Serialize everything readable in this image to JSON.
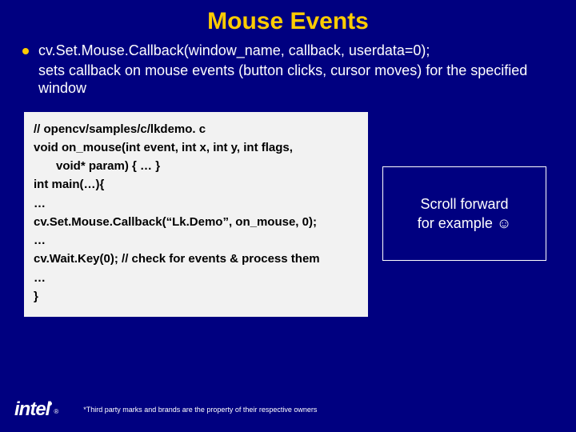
{
  "title": "Mouse Events",
  "bullet": {
    "signature": "cv.Set.Mouse.Callback(window_name, callback, userdata=0);",
    "description": "sets callback on mouse events (button clicks, cursor moves) for the specified window"
  },
  "code": {
    "l1": "// opencv/samples/c/lkdemo. c",
    "l2": "void on_mouse(int event, int x, int y, int flags,",
    "l3": "void* param) { … }",
    "l4": "int main(…){",
    "l5": "…",
    "l6": "cv.Set.Mouse.Callback(“Lk.Demo”, on_mouse, 0);",
    "l7": "…",
    "l8": "cv.Wait.Key(0); // check for events & process them",
    "l9": "…",
    "l10": "}"
  },
  "note": {
    "line1": "Scroll forward",
    "line2": "for example ☺"
  },
  "logo": {
    "text": "intel",
    "registered": "®"
  },
  "footnote": "*Third party marks and brands are the property of their respective owners"
}
